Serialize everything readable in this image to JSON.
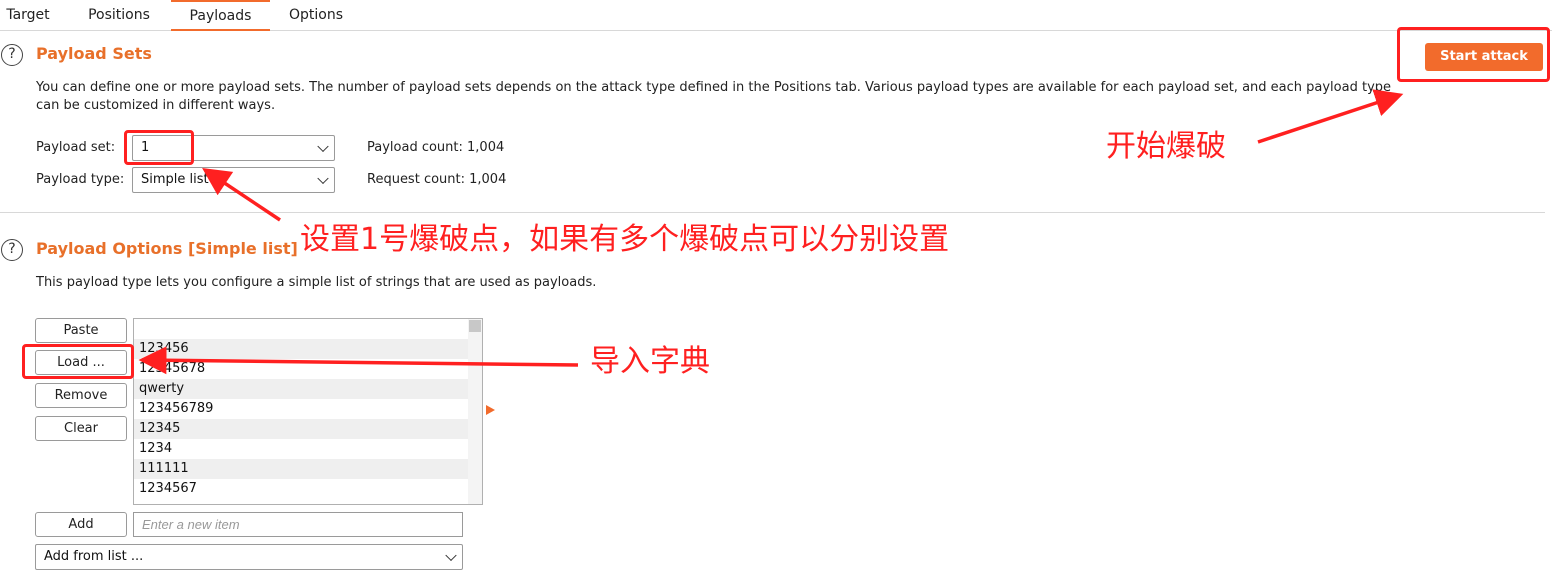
{
  "tabs": [
    {
      "label": "Target",
      "active": false
    },
    {
      "label": "Positions",
      "active": false
    },
    {
      "label": "Payloads",
      "active": true
    },
    {
      "label": "Options",
      "active": false
    }
  ],
  "accent_color": "#f26b2c",
  "annotation_color": "#ff2020",
  "payload_sets": {
    "title": "Payload Sets",
    "description": "You can define one or more payload sets. The number of payload sets depends on the attack type defined in the Positions tab. Various payload types are available for each payload set, and each payload type can be customized in different ways.",
    "start_attack_label": "Start attack",
    "payload_set_label": "Payload set:",
    "payload_set_value": "1",
    "payload_type_label": "Payload type:",
    "payload_type_value": "Simple list",
    "payload_count": "Payload count: 1,004",
    "request_count": "Request count: 1,004"
  },
  "payload_options": {
    "title": "Payload Options [Simple list]",
    "description": "This payload type lets you configure a simple list of strings that are used as payloads.",
    "buttons": {
      "paste": "Paste",
      "load": "Load ...",
      "remove": "Remove",
      "clear": "Clear",
      "add": "Add"
    },
    "items": [
      "",
      "123456",
      "12345678",
      "qwerty",
      "123456789",
      "12345",
      "1234",
      "111111",
      "1234567"
    ],
    "new_item_placeholder": "Enter a new item",
    "add_from_list_label": "Add from list ..."
  },
  "annotations": {
    "start_attack": "开始爆破",
    "payload_set": "设置1号爆破点，如果有多个爆破点可以分别设置",
    "load_dictionary": "导入字典"
  },
  "icons": {
    "help": "help-circle-icon",
    "dropdown": "chevron-down-icon",
    "expand": "triangle-right-icon"
  }
}
